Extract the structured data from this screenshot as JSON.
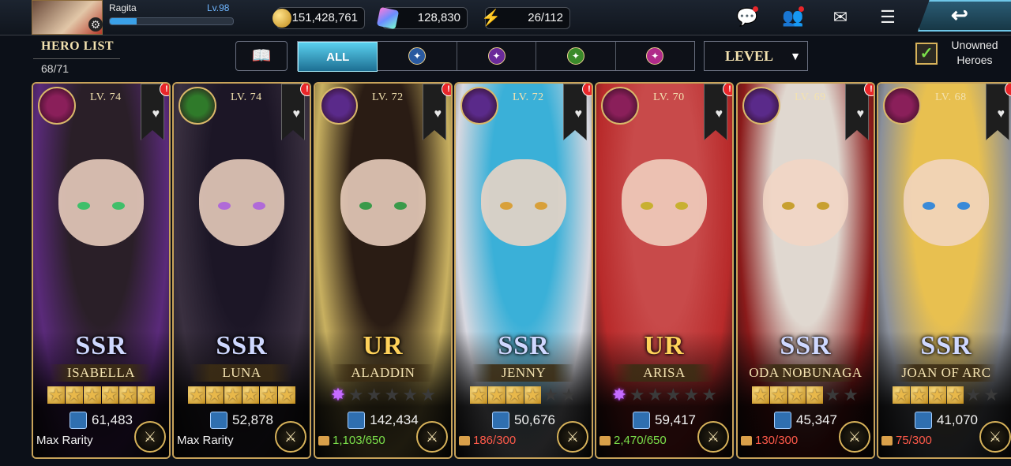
{
  "player": {
    "name": "Ragita",
    "level": "Lv.98",
    "xp_fraction": 0.22
  },
  "currencies": [
    {
      "icon": "gold-coin-icon",
      "value": "151,428,761"
    },
    {
      "icon": "crystal-gem-icon",
      "value": "128,830"
    },
    {
      "icon": "stamina-bolt-icon",
      "value": "26/112"
    }
  ],
  "header": {
    "title": "HERO LIST",
    "count": "68/71"
  },
  "filters": [
    {
      "label": "ALL",
      "icon": "",
      "active": true
    },
    {
      "label": "",
      "icon": "sword-class-icon",
      "color": "#2a5aa0"
    },
    {
      "label": "",
      "icon": "pillar-class-icon",
      "color": "#6a2a9a"
    },
    {
      "label": "",
      "icon": "target-class-icon",
      "color": "#3a8a2a"
    },
    {
      "label": "",
      "icon": "mage-class-icon",
      "color": "#b02a8a"
    }
  ],
  "sort": {
    "label": "LEVEL"
  },
  "unowned": {
    "label_line1": "Unowned",
    "label_line2": "Heroes",
    "checked": true
  },
  "heroes": [
    {
      "name": "ISABELLA",
      "level": "LV. 74",
      "rarity": "SSR",
      "power": "61,483",
      "footer": "Max Rarity",
      "footer_type": "max",
      "stars_gold": 6,
      "stars_ur": 0,
      "stars_total": 6,
      "emblem_color": "#8a1f5a",
      "hair": "#2a1f28",
      "outfit": "#5a2a7a",
      "eye": "#3fbf6a"
    },
    {
      "name": "LUNA",
      "level": "LV. 74",
      "rarity": "SSR",
      "power": "52,878",
      "footer": "Max Rarity",
      "footer_type": "max",
      "stars_gold": 6,
      "stars_ur": 0,
      "stars_total": 6,
      "emblem_color": "#2f7a2a",
      "hair": "#1c1626",
      "outfit": "#3a3040",
      "eye": "#b06ad8"
    },
    {
      "name": "ALADDIN",
      "level": "LV. 72",
      "rarity": "UR",
      "power": "142,434",
      "footer": "1,103/650",
      "footer_type": "ok",
      "stars_gold": 0,
      "stars_ur": 1,
      "stars_total": 6,
      "emblem_color": "#5a2a8a",
      "hair": "#2a1c14",
      "outfit": "#c8b060",
      "eye": "#3a9a4a"
    },
    {
      "name": "JENNY",
      "level": "LV. 72",
      "rarity": "SSR",
      "power": "50,676",
      "footer": "186/300",
      "footer_type": "low",
      "stars_gold": 4,
      "stars_ur": 0,
      "stars_total": 6,
      "emblem_color": "#5a2a8a",
      "hair": "#3ab0d8",
      "outfit": "#d8d8e0",
      "eye": "#d8a03a"
    },
    {
      "name": "ARISA",
      "level": "LV. 70",
      "rarity": "UR",
      "power": "59,417",
      "footer": "2,470/650",
      "footer_type": "ok",
      "stars_gold": 0,
      "stars_ur": 1,
      "stars_total": 6,
      "emblem_color": "#8a1f5a",
      "hair": "#c84a4a",
      "outfit": "#b82a2a",
      "eye": "#c8b030"
    },
    {
      "name": "ODA NOBUNAGA",
      "level": "LV. 69",
      "rarity": "SSR",
      "power": "45,347",
      "footer": "130/300",
      "footer_type": "low",
      "stars_gold": 4,
      "stars_ur": 0,
      "stars_total": 6,
      "emblem_color": "#5a2a8a",
      "hair": "#e0d8d0",
      "outfit": "#8a1a1a",
      "eye": "#c8a030"
    },
    {
      "name": "JOAN OF ARC",
      "level": "LV. 68",
      "rarity": "SSR",
      "power": "41,070",
      "footer": "75/300",
      "footer_type": "low",
      "stars_gold": 4,
      "stars_ur": 0,
      "stars_total": 6,
      "emblem_color": "#8a1f5a",
      "hair": "#e8c050",
      "outfit": "#8a8f9a",
      "eye": "#3a8ad8"
    }
  ],
  "colors": {
    "gold_frame": "#c8a35a",
    "ssr_text": "#cfd8ff",
    "ur_text": "#ffd25a",
    "alert": "#e8262a"
  }
}
